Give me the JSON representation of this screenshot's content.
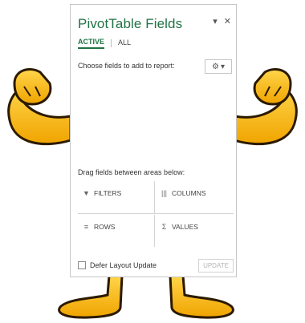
{
  "pane": {
    "title": "PivotTable Fields",
    "menu_glyph": "▾",
    "close_glyph": "✕",
    "tabs": [
      {
        "label": "ACTIVE",
        "selected": true
      },
      {
        "label": "ALL",
        "selected": false
      }
    ],
    "choose_label": "Choose fields to add to report:",
    "tools_icon": "gear-icon",
    "tools_dropdown_glyph": "▾",
    "drag_label": "Drag fields between areas below:",
    "areas": {
      "filters": {
        "label": "FILTERS",
        "icon": "filter-icon",
        "glyph": "▼"
      },
      "columns": {
        "label": "COLUMNS",
        "icon": "columns-icon",
        "glyph": "|||"
      },
      "rows": {
        "label": "ROWS",
        "icon": "rows-icon",
        "glyph": "≡"
      },
      "values": {
        "label": "VALUES",
        "icon": "sigma-icon",
        "glyph": "Σ"
      }
    },
    "defer_label": "Defer Layout Update",
    "defer_checked": false,
    "update_label": "UPDATE",
    "update_enabled": false
  },
  "colors": {
    "accent": "#217346",
    "mascot_yellow": "#f5b800",
    "mascot_dark": "#2b1a00"
  }
}
